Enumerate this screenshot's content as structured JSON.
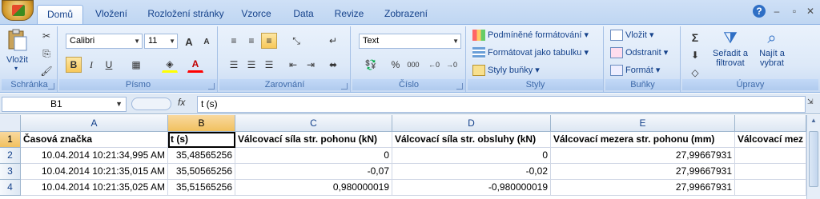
{
  "tabs": [
    "Domů",
    "Vložení",
    "Rozložení stránky",
    "Vzorce",
    "Data",
    "Revize",
    "Zobrazení"
  ],
  "window": {
    "help": "?",
    "minimize": "–",
    "restore": "▫",
    "close": "✕"
  },
  "groups": {
    "clipboard": {
      "label": "Schránka",
      "paste": "Vložit"
    },
    "font": {
      "label": "Písmo",
      "name": "Calibri",
      "size": "11",
      "grow": "A",
      "shrink": "A",
      "bold": "B",
      "italic": "I",
      "underline": "U",
      "font_color_letter": "A"
    },
    "alignment": {
      "label": "Zarovnání"
    },
    "number": {
      "label": "Číslo",
      "format": "Text",
      "percent": "%",
      "comma": "000"
    },
    "styles": {
      "label": "Styly",
      "conditional": "Podmíněné formátování",
      "table": "Formátovat jako tabulku",
      "cell_styles": "Styly buňky"
    },
    "cells": {
      "label": "Buňky",
      "insert": "Vložit",
      "delete": "Odstranit",
      "format": "Formát"
    },
    "editing": {
      "label": "Úpravy",
      "sigma": "Σ",
      "sort": "Seřadit a",
      "sort2": "filtrovat",
      "find": "Najít a",
      "find2": "vybrat"
    }
  },
  "formula_bar": {
    "name_box": "B1",
    "fx": "fx",
    "value": "t (s)"
  },
  "columns": [
    "A",
    "B",
    "C",
    "D",
    "E"
  ],
  "rows": [
    "1",
    "2",
    "3",
    "4"
  ],
  "cells": {
    "r1": [
      "Časová značka",
      "t (s)",
      "Válcovací síla str. pohonu (kN)",
      "Válcovací síla str. obsluhy (kN)",
      "Válcovací mezera str. pohonu (mm)",
      "Válcovací mez"
    ],
    "r2": [
      "10.04.2014 10:21:34,995 AM",
      "35,48565256",
      "0",
      "0",
      "27,99667931",
      ""
    ],
    "r3": [
      "10.04.2014 10:21:35,015 AM",
      "35,50565256",
      "-0,07",
      "-0,02",
      "27,99667931",
      ""
    ],
    "r4": [
      "10.04.2014 10:21:35,025 AM",
      "35,51565256",
      "0,980000019",
      "-0,980000019",
      "27,99667931",
      ""
    ]
  }
}
